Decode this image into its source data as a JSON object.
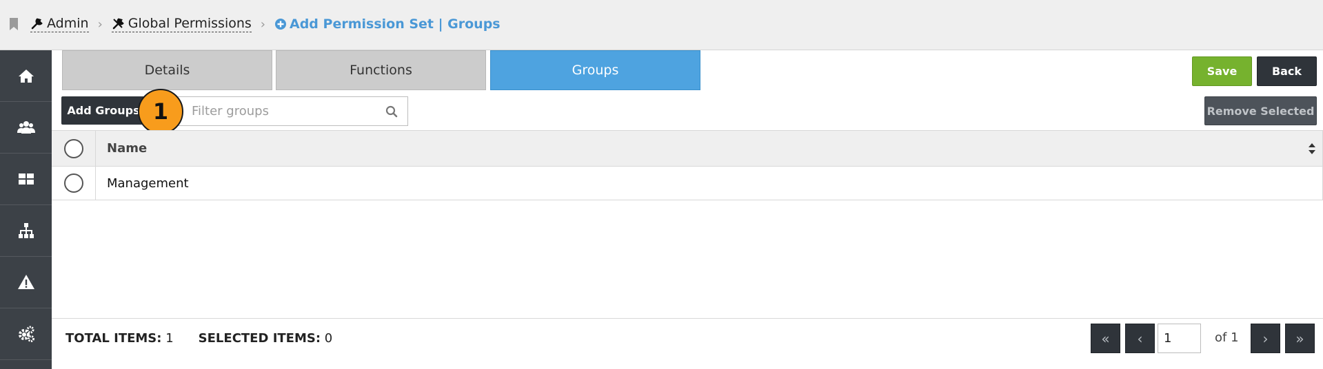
{
  "breadcrumb": {
    "items": [
      {
        "label": "Admin"
      },
      {
        "label": "Global Permissions"
      }
    ],
    "active": "Add Permission Set | Groups"
  },
  "sidebar": {
    "items": [
      {
        "icon": "home-icon"
      },
      {
        "icon": "users-icon"
      },
      {
        "icon": "dashboard-icon"
      },
      {
        "icon": "org-chart-icon"
      },
      {
        "icon": "warning-icon"
      },
      {
        "icon": "settings-icon"
      }
    ]
  },
  "tabs": [
    {
      "label": "Details",
      "active": false
    },
    {
      "label": "Functions",
      "active": false
    },
    {
      "label": "Groups",
      "active": true
    }
  ],
  "toolbar": {
    "save_label": "Save",
    "back_label": "Back",
    "add_groups_label": "Add Groups",
    "remove_selected_label": "Remove Selected",
    "search_placeholder": "Filter groups",
    "badge": "1"
  },
  "table": {
    "columns": [
      "Name"
    ],
    "rows": [
      {
        "name": "Management"
      }
    ]
  },
  "footer": {
    "total_label": "TOTAL ITEMS:",
    "total_value": "1",
    "selected_label": "SELECTED ITEMS:",
    "selected_value": "0",
    "page_value": "1",
    "of_pages": "of 1"
  },
  "colors": {
    "accent_blue": "#4ea3e0",
    "save_green": "#76b22e",
    "sidebar_dark": "#3c4147",
    "badge_orange": "#f89c1c"
  }
}
